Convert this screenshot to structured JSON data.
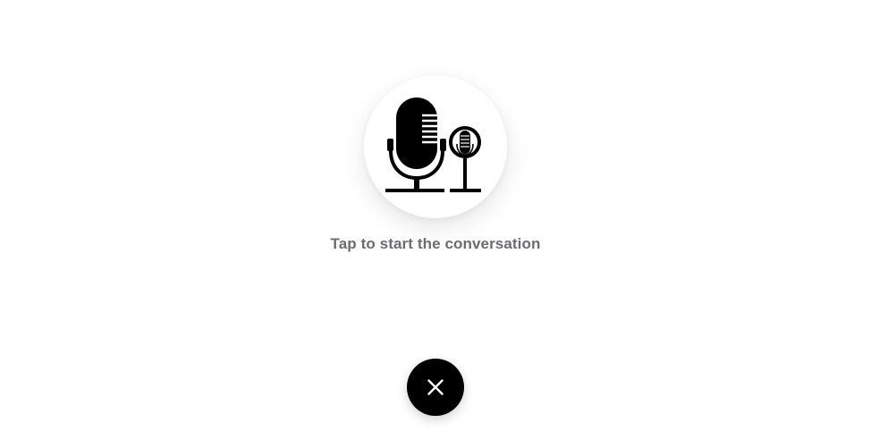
{
  "voice": {
    "prompt_text": "Tap to start the conversation",
    "microphone_icon": "microphones-icon",
    "close_icon": "close-icon"
  },
  "colors": {
    "background": "#ffffff",
    "prompt_text": "#6b6b73",
    "close_button_bg": "#000000",
    "close_icon": "#ffffff",
    "icon_ink": "#000000"
  }
}
